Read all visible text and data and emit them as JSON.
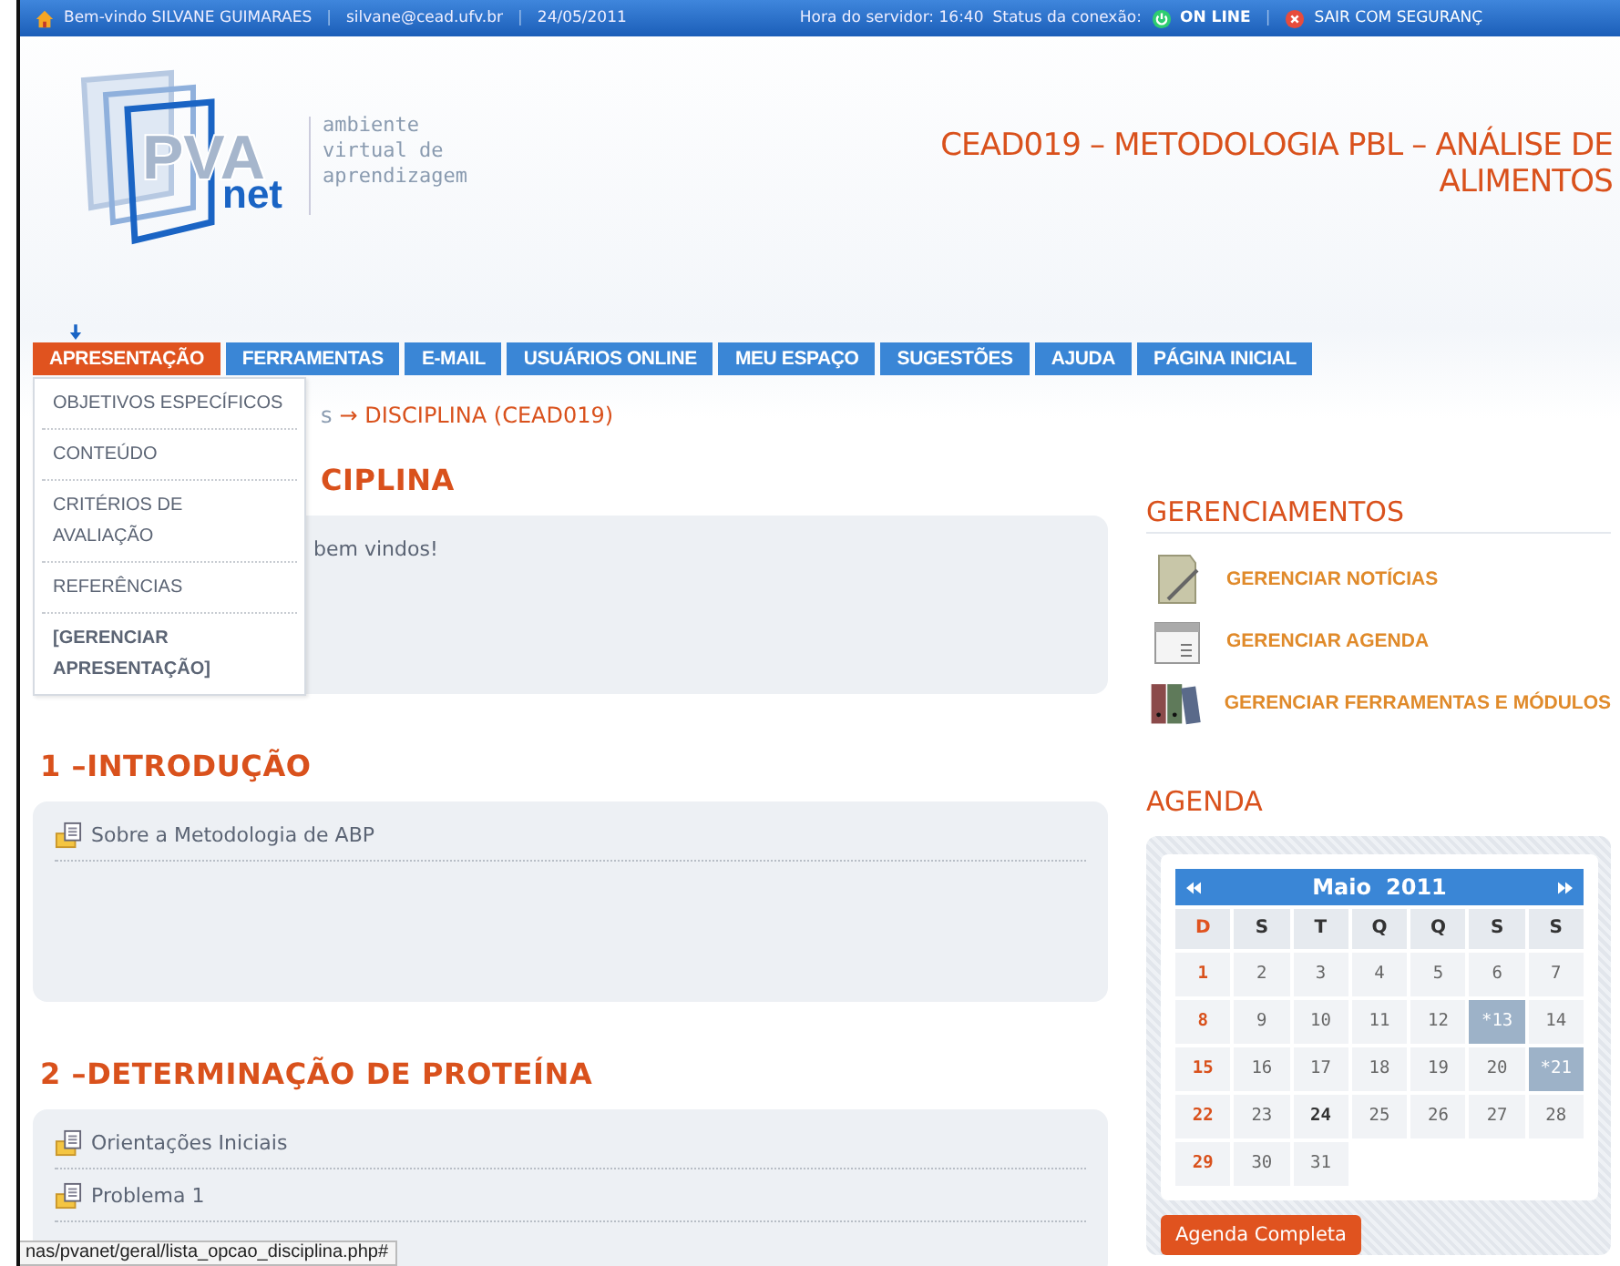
{
  "top_bar": {
    "welcome": "Bem-vindo SILVANE GUIMARAES",
    "email": "silvane@cead.ufv.br",
    "date": "24/05/2011",
    "server_time": "Hora do servidor: 16:40",
    "connection_label": "Status da conexão:",
    "connection_status": "ON LINE",
    "online": true,
    "logout": "SAIR COM SEGURANÇ",
    "separators": [
      "|",
      "|",
      "|"
    ]
  },
  "logo": {
    "mark": "PVA",
    "sub": "net",
    "tagline": [
      "ambiente",
      "virtual de",
      "aprendizagem"
    ]
  },
  "course_title": "CEAD019 – METODOLOGIA PBL – ANÁLISE DE ALIMENTOS",
  "nav": [
    {
      "label": "APRESENTAÇÃO",
      "selected": true
    },
    {
      "label": "FERRAMENTAS",
      "selected": false
    },
    {
      "label": "E-MAIL",
      "selected": false
    },
    {
      "label": "USUÁRIOS ONLINE",
      "selected": false
    },
    {
      "label": "MEU ESPAÇO",
      "selected": false
    },
    {
      "label": "SUGESTÕES",
      "selected": false
    },
    {
      "label": "AJUDA",
      "selected": false
    },
    {
      "label": "PÁGINA INICIAL",
      "selected": false
    }
  ],
  "dropdown": [
    {
      "label": "OBJETIVOS ESPECÍFICOS",
      "kind": "link"
    },
    {
      "label": "CONTEÚDO",
      "kind": "link"
    },
    {
      "label": "CRITÉRIOS DE AVALIAÇÃO",
      "kind": "link"
    },
    {
      "label": "REFERÊNCIAS",
      "kind": "link"
    },
    {
      "label": "[GERENCIAR APRESENTAÇÃO]",
      "kind": "manage"
    }
  ],
  "breadcrumb": {
    "visible_part": "s",
    "current": "→ DISCIPLINA (CEAD019)"
  },
  "sections": [
    {
      "title": "CIPLINA",
      "items": [
        {
          "text": "bem vindos!",
          "kind": "text"
        }
      ]
    },
    {
      "title": "1 –INTRODUÇÃO",
      "items": [
        {
          "text": "Sobre a Metodologia de ABP",
          "kind": "link"
        }
      ]
    },
    {
      "title": "2 –DETERMINAÇÃO DE PROTEÍNA",
      "items": [
        {
          "text": "Orientações Iniciais",
          "kind": "link"
        },
        {
          "text": "Problema 1",
          "kind": "link"
        }
      ]
    }
  ],
  "management": {
    "title": "GERENCIAMENTOS",
    "items": [
      {
        "label": "GERENCIAR NOTÍCIAS",
        "kind": "news"
      },
      {
        "label": "GERENCIAR AGENDA",
        "kind": "calendar"
      },
      {
        "label": "GERENCIAR FERRAMENTAS E MÓDULOS",
        "kind": "tools"
      }
    ]
  },
  "agenda": {
    "title": "AGENDA",
    "month": "Maio",
    "year": "2011",
    "weekdays": [
      "D",
      "S",
      "T",
      "Q",
      "Q",
      "S",
      "S"
    ],
    "weeks": [
      [
        {
          "day": "1",
          "event": false,
          "today": false
        },
        {
          "day": "2",
          "event": false,
          "today": false
        },
        {
          "day": "3",
          "event": false,
          "today": false
        },
        {
          "day": "4",
          "event": false,
          "today": false
        },
        {
          "day": "5",
          "event": false,
          "today": false
        },
        {
          "day": "6",
          "event": false,
          "today": false
        },
        {
          "day": "7",
          "event": false,
          "today": false
        }
      ],
      [
        {
          "day": "8",
          "event": false,
          "today": false
        },
        {
          "day": "9",
          "event": false,
          "today": false
        },
        {
          "day": "10",
          "event": false,
          "today": false
        },
        {
          "day": "11",
          "event": false,
          "today": false
        },
        {
          "day": "12",
          "event": false,
          "today": false
        },
        {
          "day": "*13",
          "event": true,
          "today": false
        },
        {
          "day": "14",
          "event": false,
          "today": false
        }
      ],
      [
        {
          "day": "15",
          "event": false,
          "today": false
        },
        {
          "day": "16",
          "event": false,
          "today": false
        },
        {
          "day": "17",
          "event": false,
          "today": false
        },
        {
          "day": "18",
          "event": false,
          "today": false
        },
        {
          "day": "19",
          "event": false,
          "today": false
        },
        {
          "day": "20",
          "event": false,
          "today": false
        },
        {
          "day": "*21",
          "event": true,
          "today": false
        }
      ],
      [
        {
          "day": "22",
          "event": false,
          "today": false
        },
        {
          "day": "23",
          "event": false,
          "today": false
        },
        {
          "day": "24",
          "event": false,
          "today": true
        },
        {
          "day": "25",
          "event": false,
          "today": false
        },
        {
          "day": "26",
          "event": false,
          "today": false
        },
        {
          "day": "27",
          "event": false,
          "today": false
        },
        {
          "day": "28",
          "event": false,
          "today": false
        }
      ],
      [
        {
          "day": "29",
          "event": false,
          "today": false
        },
        {
          "day": "30",
          "event": false,
          "today": false
        },
        {
          "day": "31",
          "event": false,
          "today": false
        }
      ]
    ],
    "button": "Agenda Completa"
  },
  "status_bar": "nas/pvanet/geral/lista_opcao_disciplina.php#"
}
